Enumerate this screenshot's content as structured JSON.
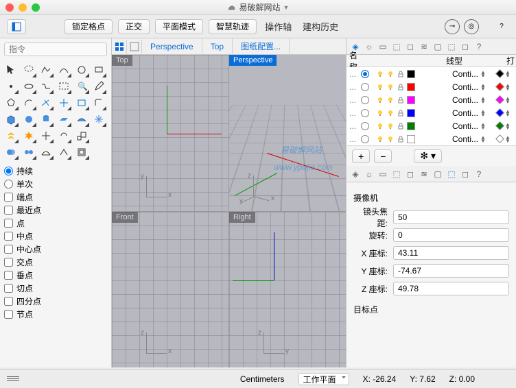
{
  "window": {
    "title": "易破解网站",
    "dropdown_icon": "▾"
  },
  "toolbar": {
    "lock_grid": "锁定格点",
    "ortho": "正交",
    "planar": "平面模式",
    "smarttrack": "智慧轨迹",
    "gumball": "操作轴",
    "history": "建构历史"
  },
  "cmd_placeholder": "指令",
  "osnap": {
    "persist": "持续",
    "single": "单次",
    "items": [
      "端点",
      "最近点",
      "点",
      "中点",
      "中心点",
      "交点",
      "垂点",
      "切点",
      "四分点",
      "节点"
    ]
  },
  "viewport_tabs": {
    "perspective": "Perspective",
    "top": "Top",
    "config": "图纸配置..."
  },
  "viewports": {
    "top": "Top",
    "persp": "Perspective",
    "front": "Front",
    "right": "Right"
  },
  "layers": {
    "hdr_name": "名称",
    "hdr_linetype": "线型",
    "hdr_print": "打",
    "rows": [
      {
        "color": "#000000",
        "linetype": "Conti...",
        "active": true,
        "fill": true
      },
      {
        "color": "#ff0000",
        "linetype": "Conti...",
        "active": false,
        "fill": true
      },
      {
        "color": "#ff00ff",
        "linetype": "Conti...",
        "active": false,
        "fill": true
      },
      {
        "color": "#0000ff",
        "linetype": "Conti...",
        "active": false,
        "fill": true
      },
      {
        "color": "#008000",
        "linetype": "Conti...",
        "active": false,
        "fill": true
      },
      {
        "color": "#ffffff",
        "linetype": "Conti...",
        "active": false,
        "fill": false
      }
    ]
  },
  "props": {
    "camera": "摄像机",
    "focal_label": "镜头焦距:",
    "focal": "50",
    "rot_label": "旋转:",
    "rot": "0",
    "x_label": "X 座标:",
    "x": "43.11",
    "y_label": "Y 座标:",
    "y": "-74.67",
    "z_label": "Z 座标:",
    "z": "49.78",
    "target": "目标点"
  },
  "status": {
    "units": "Centimeters",
    "cplane": "工作平面",
    "x_lbl": "X:",
    "x": "-26.24",
    "y_lbl": "Y:",
    "y": "7.62",
    "z_lbl": "Z:",
    "z": "0.00"
  },
  "watermark": {
    "l1": "易破解网站",
    "l2": "www.ypojie.com"
  }
}
